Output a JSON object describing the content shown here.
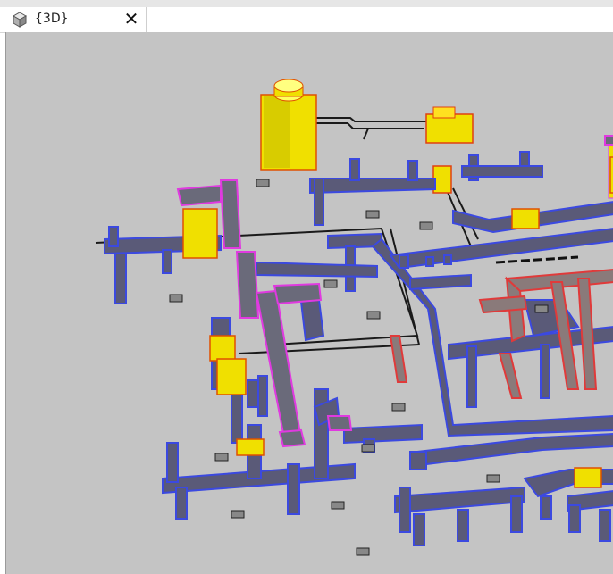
{
  "window": {
    "tab_title": "{3D}",
    "tab_icon": "3d-cube-icon",
    "close_icon": "close-icon",
    "close_glyph": "✕"
  },
  "viewport": {
    "view_name": "3D view",
    "background_color": "#c4c4c4",
    "element_colors": {
      "supply_duct": "#3b49e0",
      "duct_fill": "#5a5a7a",
      "exhaust_duct": "#e03a3a",
      "equipment": "#f0e000",
      "equipment_outline": "#e05000",
      "selected_duct": "#e03ae0",
      "pipe": "#1a1a1a"
    }
  }
}
